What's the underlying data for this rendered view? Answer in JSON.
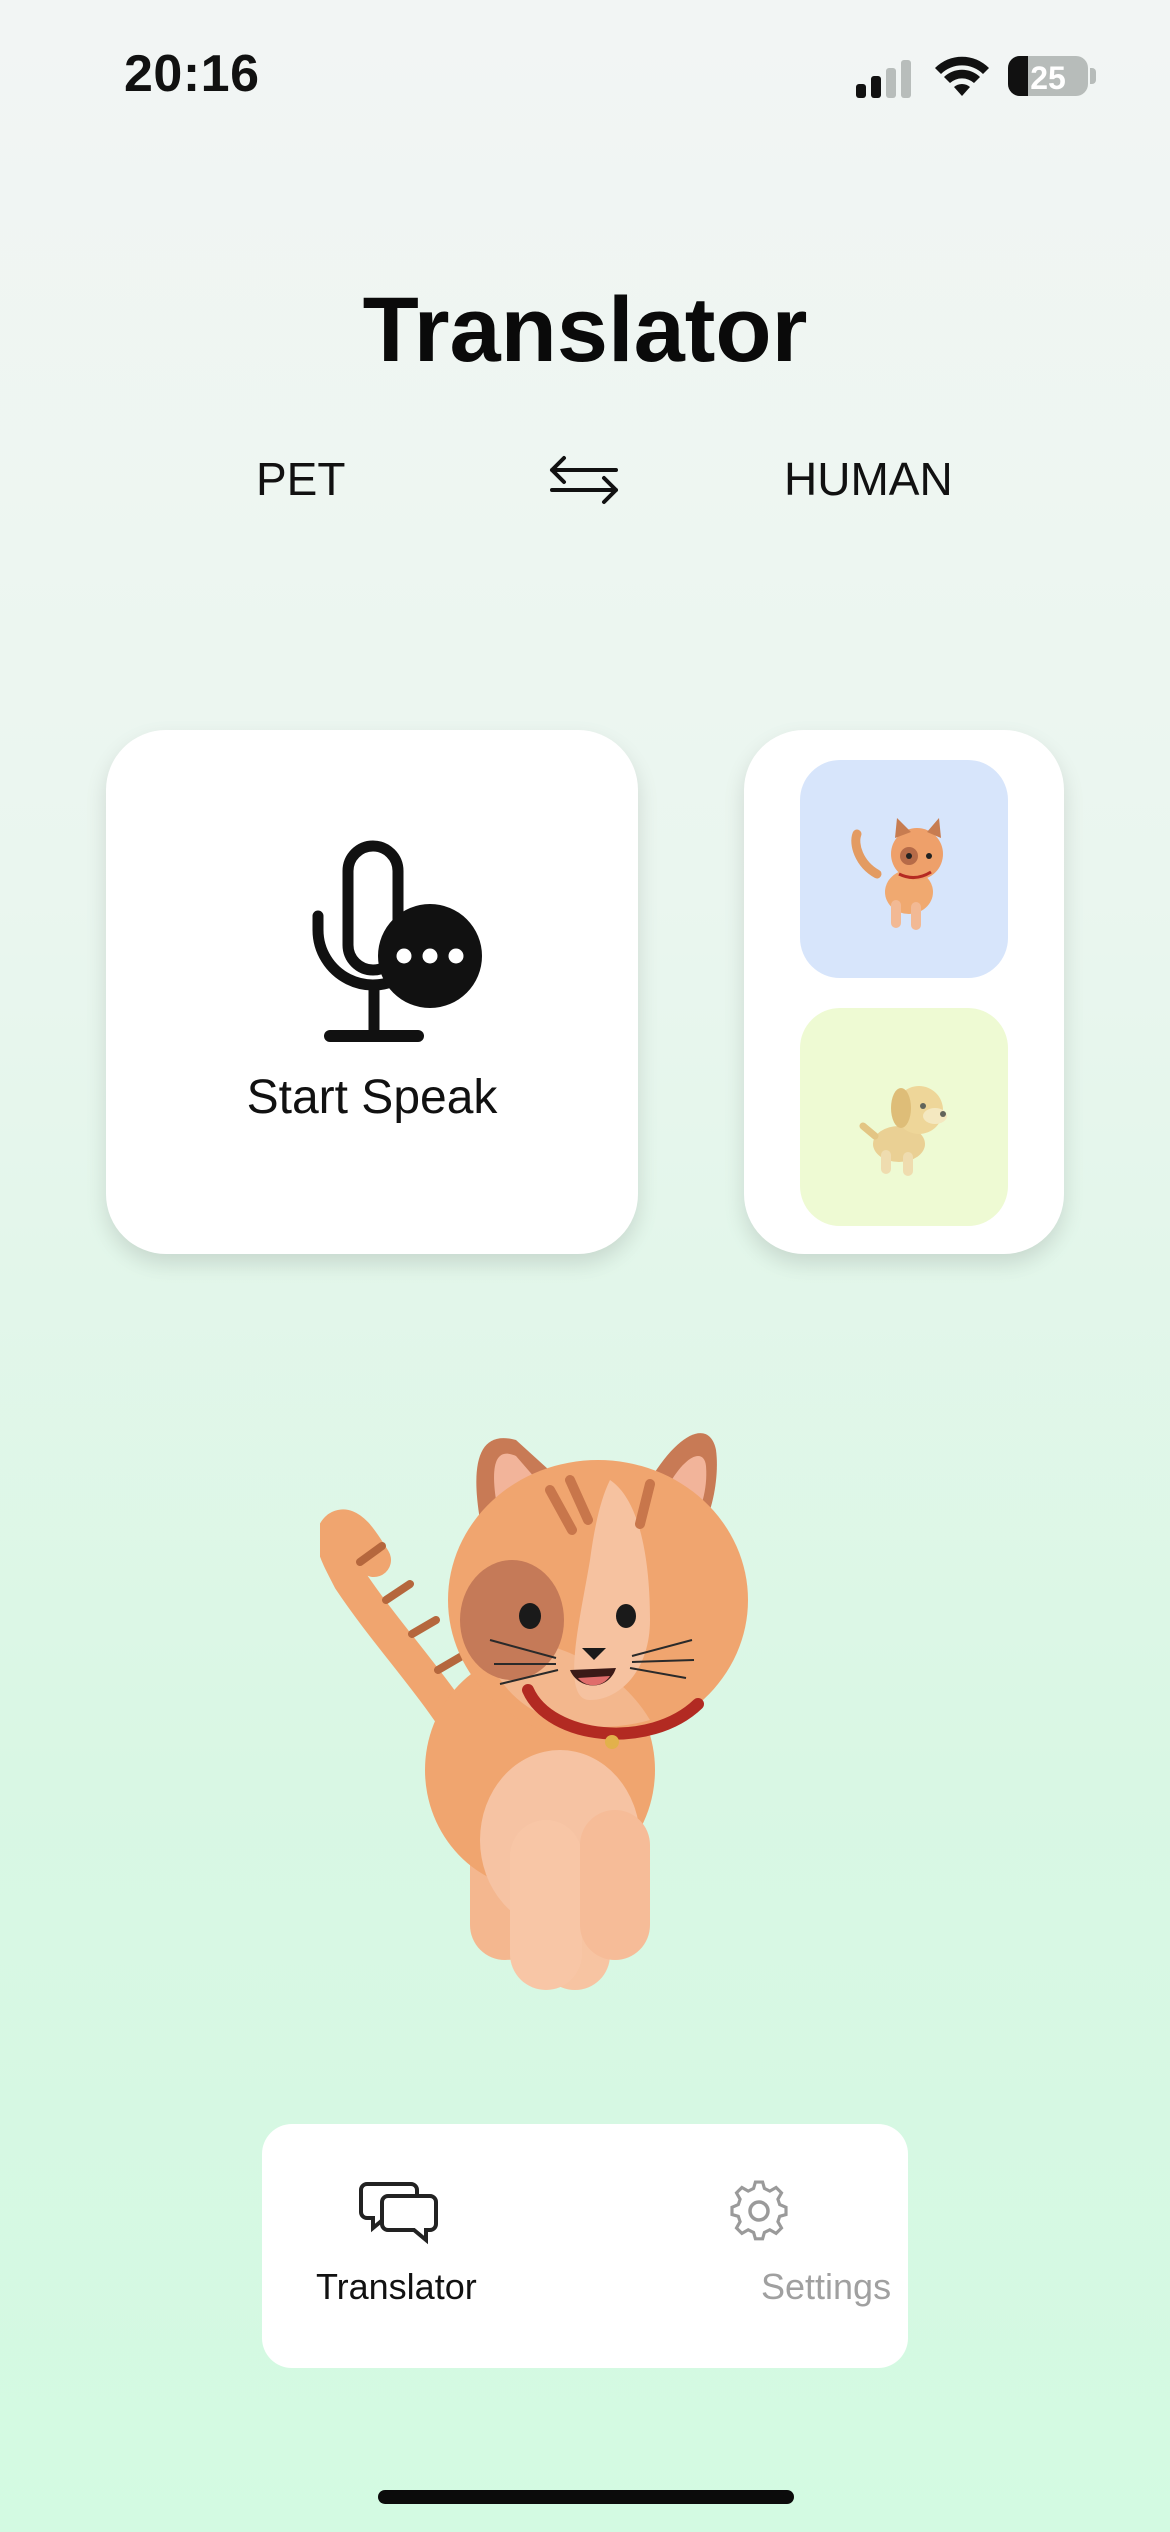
{
  "status_bar": {
    "time": "20:16",
    "battery_percent": "25",
    "battery_level": 0.25,
    "icons": [
      "signal-icon",
      "wifi-icon",
      "battery-icon"
    ]
  },
  "header": {
    "title": "Translator"
  },
  "language_switch": {
    "left": "PET",
    "right": "HUMAN",
    "swap_icon": "swap-arrows-icon"
  },
  "speak_card": {
    "label": "Start Speak",
    "icon": "microphone-speech-icon"
  },
  "pet_selector": {
    "items": [
      {
        "name": "cat",
        "tile_color": "#d7e5fb",
        "selected": true
      },
      {
        "name": "dog",
        "tile_color": "#eefad3",
        "selected": false
      }
    ]
  },
  "tab_bar": {
    "tabs": [
      {
        "label": "Translator",
        "icon": "chat-bubbles-icon",
        "active": true
      },
      {
        "label": "Settings",
        "icon": "gear-icon",
        "active": false
      }
    ]
  },
  "colors": {
    "background_top": "#f2f5f4",
    "background_bottom": "#d3fae2",
    "text_primary": "#111111",
    "text_inactive": "#a0a0a0"
  }
}
